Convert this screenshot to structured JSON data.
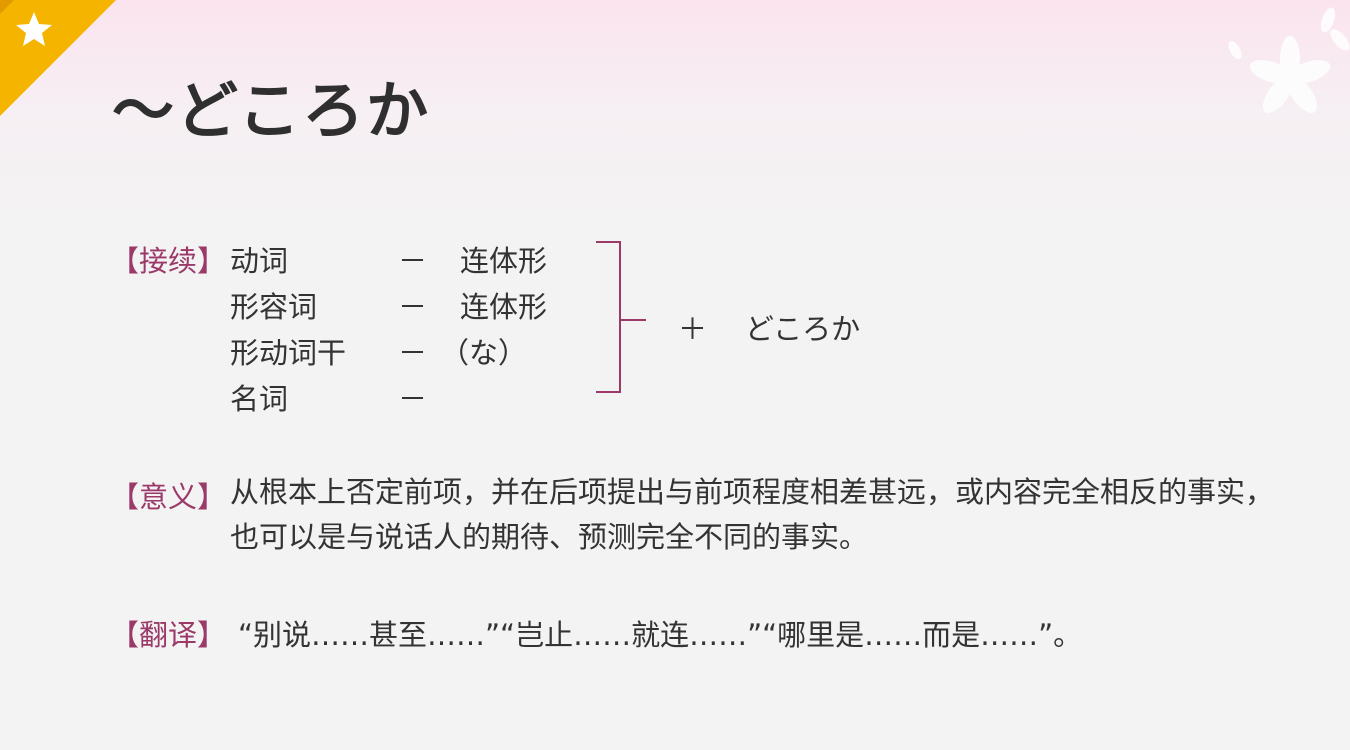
{
  "title": "～どころか",
  "connection": {
    "label": "【接续】",
    "rows": [
      {
        "word": "动词",
        "dash": "－",
        "form": "连体形"
      },
      {
        "word": "形容词",
        "dash": "－",
        "form": "连体形"
      },
      {
        "word": "形动词干",
        "dash": "－",
        "form": "（な）"
      },
      {
        "word": "名词",
        "dash": "－",
        "form": ""
      }
    ],
    "plus": "＋",
    "suffix": "どころか"
  },
  "meaning": {
    "label": "【意义】",
    "text": "从根本上否定前项，并在后项提出与前项程度相差甚远，或内容完全相反的事实，也可以是与说话人的期待、预测完全不同的事实。"
  },
  "translation": {
    "label": "【翻译】",
    "text": "“别说……甚至……”“岂止……就连……”“哪里是……而是……”。"
  },
  "colors": {
    "accent": "#9b3a69",
    "corner": "#f5b400",
    "background": "#f3f3f3"
  }
}
